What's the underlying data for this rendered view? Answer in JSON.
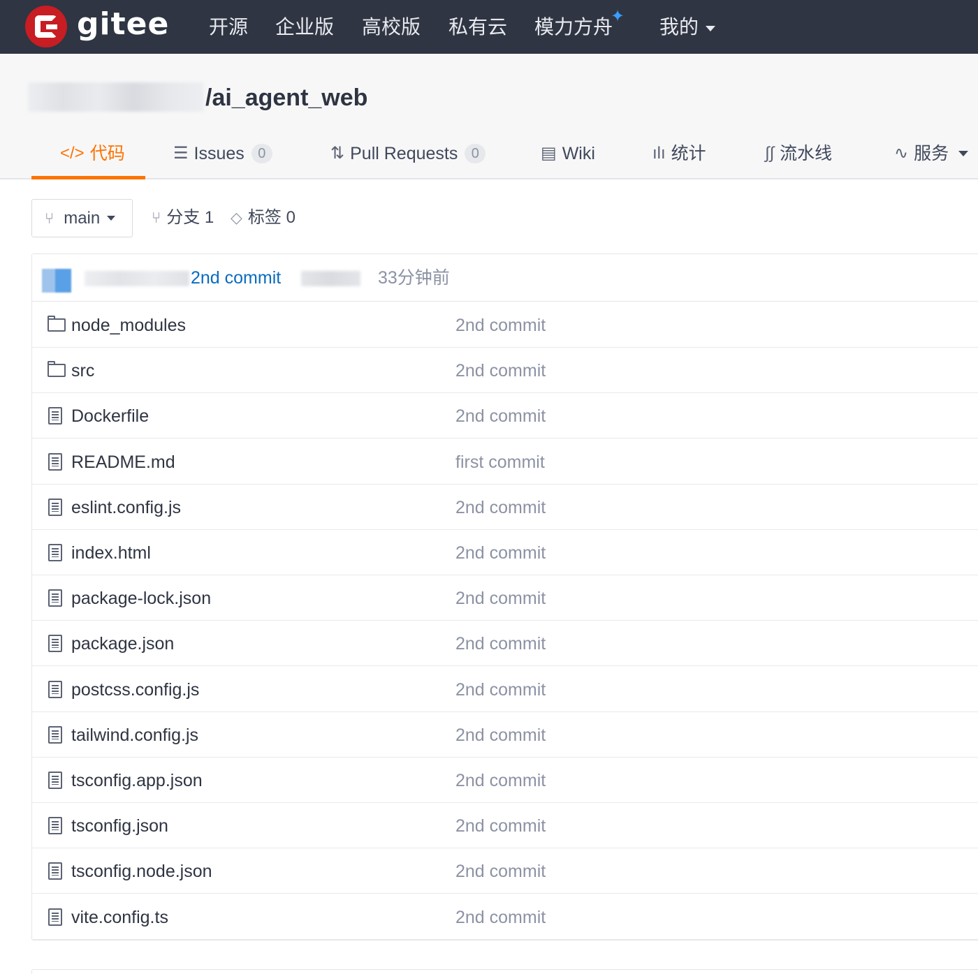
{
  "brand": {
    "name": "gitee",
    "color": "#c71d23"
  },
  "topnav": {
    "items": [
      "开源",
      "企业版",
      "高校版",
      "私有云",
      "模力方舟"
    ],
    "star": "✦",
    "mine": "我的"
  },
  "repo": {
    "title": "/ai_agent_web"
  },
  "tabs": {
    "code": "代码",
    "issues": "Issues",
    "issues_count": "0",
    "pulls": "Pull Requests",
    "pulls_count": "0",
    "wiki": "Wiki",
    "stats": "统计",
    "pipeline": "流水线",
    "services": "服务"
  },
  "branch": {
    "current": "main",
    "branches_label": "分支 1",
    "tags_label": "标签 0"
  },
  "latest_commit": {
    "message": "2nd commit",
    "time": "33分钟前"
  },
  "files": [
    {
      "type": "folder",
      "name": "node_modules",
      "commit": "2nd commit"
    },
    {
      "type": "folder",
      "name": "src",
      "commit": "2nd commit"
    },
    {
      "type": "file",
      "name": "Dockerfile",
      "commit": "2nd commit"
    },
    {
      "type": "file",
      "name": "README.md",
      "commit": "first commit"
    },
    {
      "type": "file",
      "name": "eslint.config.js",
      "commit": "2nd commit"
    },
    {
      "type": "file",
      "name": "index.html",
      "commit": "2nd commit"
    },
    {
      "type": "file",
      "name": "package-lock.json",
      "commit": "2nd commit"
    },
    {
      "type": "file",
      "name": "package.json",
      "commit": "2nd commit"
    },
    {
      "type": "file",
      "name": "postcss.config.js",
      "commit": "2nd commit"
    },
    {
      "type": "file",
      "name": "tailwind.config.js",
      "commit": "2nd commit"
    },
    {
      "type": "file",
      "name": "tsconfig.app.json",
      "commit": "2nd commit"
    },
    {
      "type": "file",
      "name": "tsconfig.json",
      "commit": "2nd commit"
    },
    {
      "type": "file",
      "name": "tsconfig.node.json",
      "commit": "2nd commit"
    },
    {
      "type": "file",
      "name": "vite.config.ts",
      "commit": "2nd commit"
    }
  ],
  "colors": {
    "accent": "#fe7300",
    "link": "#0a6bbf",
    "navbar": "#2f3542"
  }
}
